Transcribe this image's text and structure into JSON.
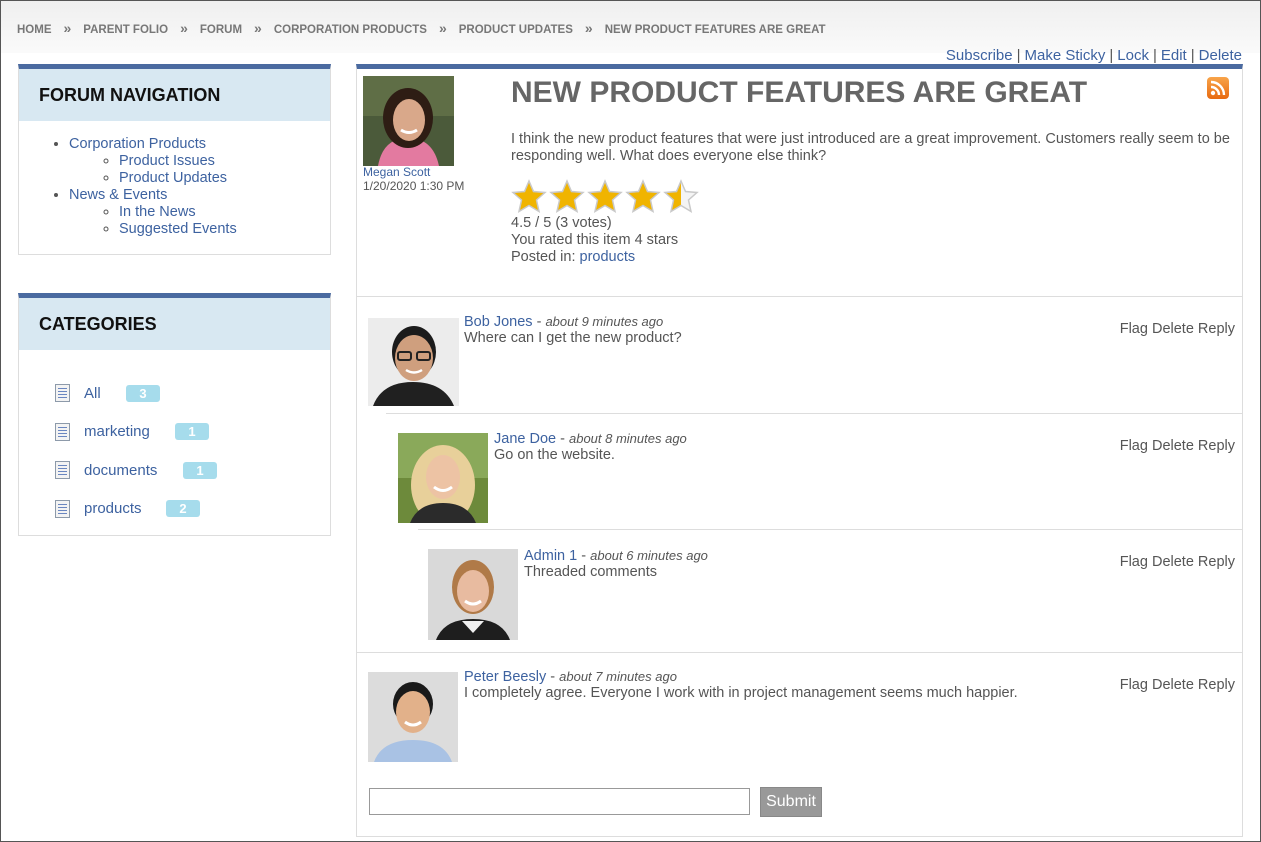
{
  "breadcrumb": [
    "HOME",
    "PARENT FOLIO",
    "FORUM",
    "CORPORATION PRODUCTS",
    "PRODUCT UPDATES",
    "NEW PRODUCT FEATURES ARE GREAT"
  ],
  "breadcrumb_separator": "»",
  "actions": {
    "subscribe": "Subscribe",
    "make_sticky": "Make Sticky",
    "lock": "Lock",
    "edit": "Edit",
    "delete": "Delete",
    "pipe": "|"
  },
  "forum_nav": {
    "title": "FORUM NAVIGATION",
    "groups": [
      {
        "label": "Corporation Products",
        "children": [
          "Product Issues",
          "Product Updates"
        ]
      },
      {
        "label": "News & Events",
        "children": [
          "In the News",
          "Suggested Events"
        ]
      }
    ]
  },
  "categories": {
    "title": "CATEGORIES",
    "items": [
      {
        "label": "All",
        "count": "3"
      },
      {
        "label": "marketing",
        "count": "1"
      },
      {
        "label": "documents",
        "count": "1"
      },
      {
        "label": "products",
        "count": "2"
      }
    ]
  },
  "post": {
    "author": "Megan Scott",
    "date": "1/20/2020 1:30 PM",
    "title": "NEW PRODUCT FEATURES ARE GREAT",
    "body": "I think the new product features that were just introduced are a great improvement. Customers really seem to be responding well. What does everyone else think?",
    "rating": 4.5,
    "rating_text": "4.5 / 5 (3 votes)",
    "user_rating_text": "You rated this item 4 stars",
    "posted_in_label": "Posted in:",
    "posted_in_link": "products"
  },
  "comment_actions": {
    "flag": "Flag",
    "delete": "Delete",
    "reply": "Reply"
  },
  "comments": [
    {
      "author": "Bob Jones",
      "time": "about 9 minutes ago",
      "text": "Where can I get the new product?"
    },
    {
      "author": "Jane Doe",
      "time": "about 8 minutes ago",
      "text": "Go on the website."
    },
    {
      "author": "Admin 1",
      "time": "about 6 minutes ago",
      "text": "Threaded comments"
    },
    {
      "author": "Peter Beesly",
      "time": "about 7 minutes ago",
      "text": "I completely agree. Everyone I work with in project management seems much happier."
    }
  ],
  "reply_form": {
    "value": "",
    "submit_label": "Submit"
  },
  "colors": {
    "accent": "#4a6aa0",
    "link": "#3d62a0",
    "panel_header": "#d8e8f2",
    "badge": "#a6dcec",
    "star": "#f0b400"
  },
  "icons": {
    "rss": "rss-icon",
    "category": "document-icon",
    "star": "star-icon"
  }
}
